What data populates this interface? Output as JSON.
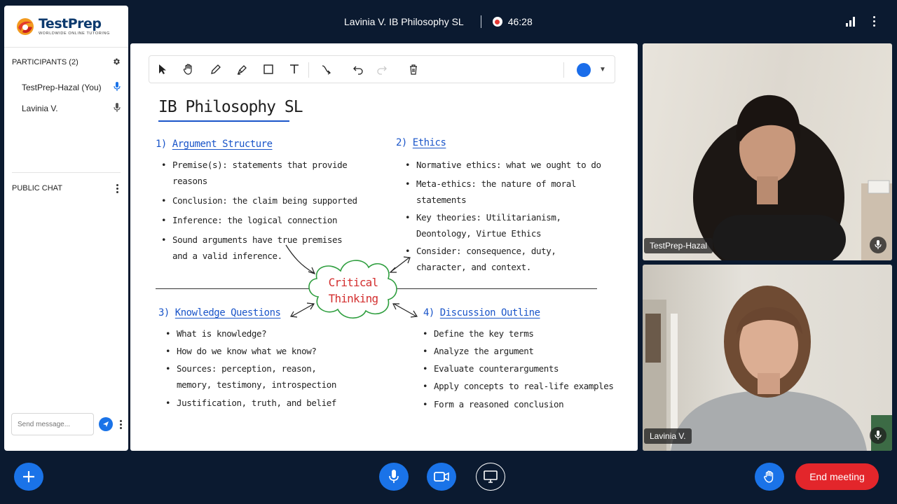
{
  "brand": {
    "name": "TestPrep",
    "tagline": "WORLDWIDE ONLINE TUTORING"
  },
  "header": {
    "title": "Lavinia V. IB Philosophy SL",
    "timer": "46:28"
  },
  "participants": {
    "heading": "PARTICIPANTS (2)",
    "items": [
      {
        "name": "TestPrep-Hazal (You)",
        "mic_active": true
      },
      {
        "name": "Lavinia V.",
        "mic_active": false
      }
    ]
  },
  "chat": {
    "heading": "PUBLIC CHAT",
    "placeholder": "Send message..."
  },
  "whiteboard": {
    "title": "IB Philosophy SL",
    "color": "#1a6dea",
    "center": {
      "line1": "Critical",
      "line2": "Thinking"
    },
    "sections": [
      {
        "number": "1)",
        "title": "Argument Structure",
        "bullets": [
          "Premise(s): statements that provide reasons",
          "Conclusion: the claim being supported",
          "Inference: the logical connection",
          "Sound arguments have true premises and a valid inference."
        ]
      },
      {
        "number": "2)",
        "title": "Ethics",
        "bullets": [
          "Normative ethics: what we ought to do",
          "Meta-ethics: the nature of moral statements",
          "Key theories: Utilitarianism, Deontology, Virtue Ethics",
          "Consider: consequence, duty, character, and context."
        ]
      },
      {
        "number": "3)",
        "title": "Knowledge Questions",
        "bullets": [
          "What is knowledge?",
          "How do we know what we know?",
          "Sources: perception, reason, memory, testimony, introspection",
          "Justification, truth, and belief"
        ]
      },
      {
        "number": "4)",
        "title": "Discussion Outline",
        "bullets": [
          "Define the key terms",
          "Analyze the argument",
          "Evaluate counterarguments",
          "Apply concepts to real-life examples",
          "Form a reasoned conclusion"
        ]
      }
    ]
  },
  "videos": [
    {
      "name": "TestPrep-Hazal"
    },
    {
      "name": "Lavinia V."
    }
  ],
  "controls": {
    "end_label": "End meeting"
  },
  "colors": {
    "accent": "#1a73e8",
    "danger": "#e3262b",
    "background": "#0b1a30"
  }
}
